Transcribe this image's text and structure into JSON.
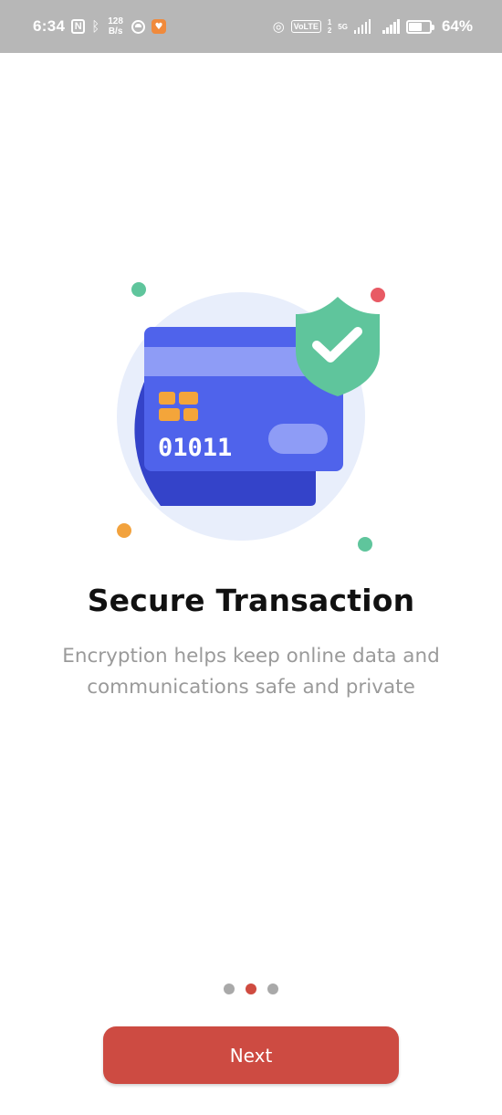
{
  "status_bar": {
    "time": "6:34",
    "nfc_label": "N",
    "net_speed_value": "128",
    "net_speed_unit": "B/s",
    "volte_label": "VoLTE",
    "sim_slot_1": "1",
    "sim_slot_2": "2",
    "network_type": "5G",
    "battery_percent": "64%",
    "battery_level": 0.64
  },
  "illustration": {
    "card_number": "01011",
    "colors": {
      "circle_bg": "#e8eefb",
      "card_front": "#4f63eb",
      "card_back": "#3443c9",
      "stripe": "#8e9cf6",
      "chip": "#f4a53a",
      "shield": "#5fc59c",
      "dot_green": "#5fc59c",
      "dot_red": "#e85a64",
      "dot_orange": "#f2a23d"
    }
  },
  "onboarding": {
    "title": "Secure Transaction",
    "description_line1": "Encryption helps keep online data and",
    "description_line2": "communications safe and private"
  },
  "pager": {
    "total_pages": 3,
    "current_page": 2
  },
  "next_button": {
    "label": "Next",
    "color": "#cd4b42"
  }
}
